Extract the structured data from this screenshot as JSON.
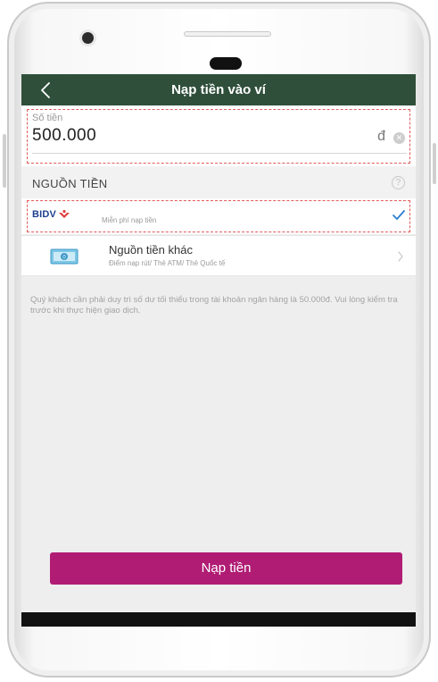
{
  "header": {
    "title": "Nạp tiền vào ví"
  },
  "amount": {
    "label": "Số tiền",
    "value": "500.000",
    "currency": "đ"
  },
  "source": {
    "title": "NGUỒN TIỀN",
    "options": [
      {
        "logo_text": "BIDV",
        "description": "Miễn phí nạp tiền",
        "selected": true
      },
      {
        "title": "Nguồn tiền khác",
        "description": "Điểm nạp rút/ Thẻ ATM/ Thẻ Quốc tế"
      }
    ]
  },
  "notice": "Quý khách cần phải duy trì số dư tối thiểu trong tài khoản ngân hàng là 50.000đ. Vui lòng kiểm tra trước khi thực hiện giao dịch.",
  "actions": {
    "submit_label": "Nạp tiền"
  },
  "colors": {
    "header_bg": "#2f4f3a",
    "button_bg": "#b01c74",
    "selected_check": "#2a7fd4",
    "bank_blue": "#1d3f8f",
    "bank_red": "#e23b3b",
    "highlight_outline": "#e25a5a"
  },
  "icons": [
    "back-arrow-icon",
    "clear-icon",
    "help-icon",
    "bidv-logo-icon",
    "check-icon",
    "money-icon",
    "chevron-right-icon"
  ]
}
